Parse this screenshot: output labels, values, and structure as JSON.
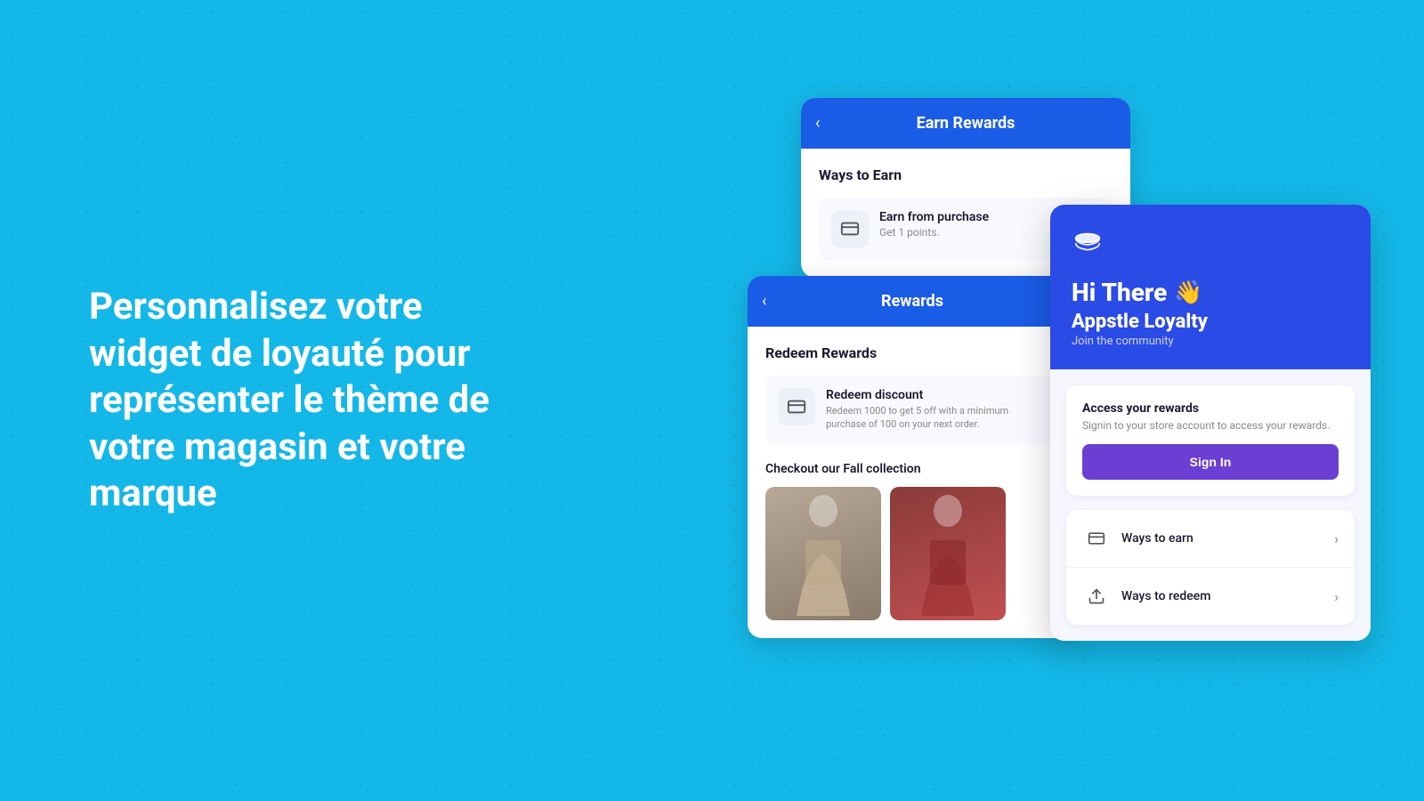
{
  "hero": {
    "text": "Personnalisez votre widget de loyauté pour représenter le thème de votre magasin et votre marque"
  },
  "card_earn": {
    "back_button": "‹",
    "title": "Earn Rewards",
    "ways_title": "Ways to Earn",
    "earn_item": {
      "label": "Earn from purchase",
      "sub": "Get 1 points."
    }
  },
  "card_rewards": {
    "back_button": "‹",
    "title": "Rewards",
    "redeem_title": "Redeem Rewards",
    "redeem_item": {
      "label": "Redeem discount",
      "sub": "Redeem 1000 to get 5 off with a minimum purchase of 100 on your next order."
    },
    "checkout_title": "Checkout our Fall collection"
  },
  "card_loyalty": {
    "greeting": "Hi There",
    "wave": "👋",
    "brand": "Appstle Loyalty",
    "tagline": "Join the community",
    "access_title": "Access your rewards",
    "access_desc": "Signin to your store account to access your rewards.",
    "sign_in_label": "Sign In",
    "links": [
      {
        "id": "ways-to-earn",
        "label": "Ways to earn"
      },
      {
        "id": "ways-to-redeem",
        "label": "Ways to redeem"
      }
    ]
  },
  "icons": {
    "back": "‹",
    "chevron_right": "›",
    "database": "🗄",
    "cash": "💵",
    "tag": "🏷"
  }
}
